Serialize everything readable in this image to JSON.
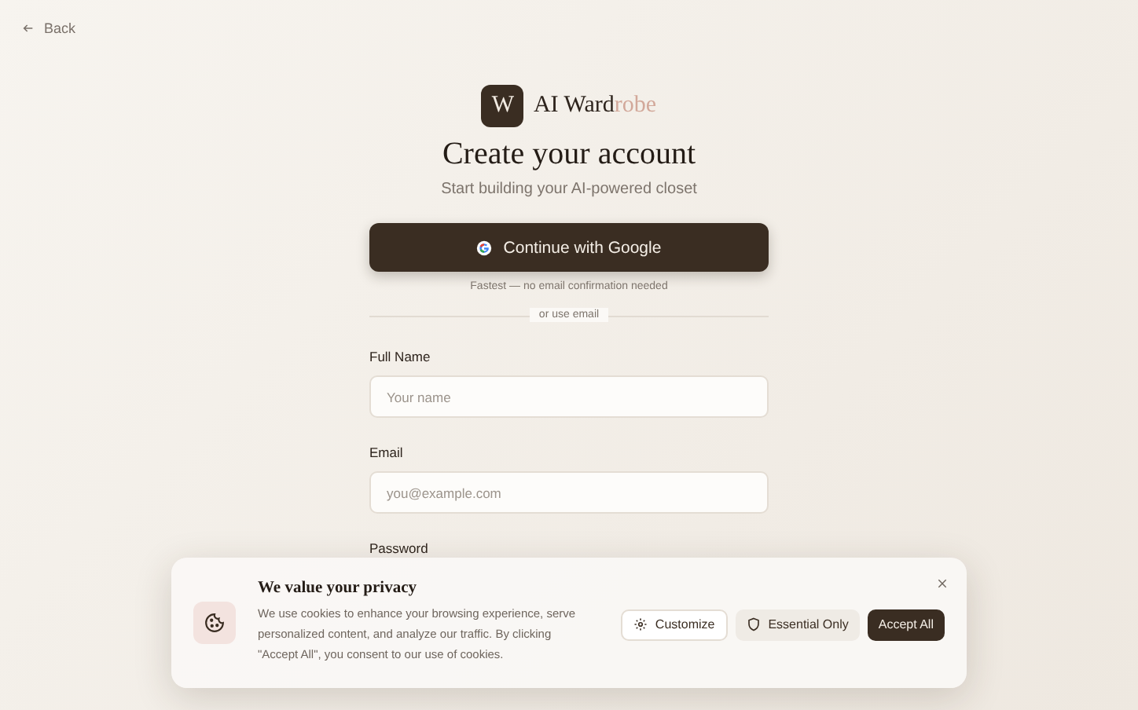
{
  "back_link": {
    "label": "Back"
  },
  "brand": {
    "mark": "W",
    "name_plain": "AI Ward",
    "name_accent": "robe"
  },
  "title": "Create your account",
  "subtitle": "Start building your AI-powered closet",
  "google_button": {
    "label": "Continue with Google"
  },
  "google_note": "Fastest — no email confirmation needed",
  "divider_label": "or use email",
  "fields": [
    {
      "label": "Full Name",
      "placeholder": "Your name"
    },
    {
      "label": "Email",
      "placeholder": "you@example.com"
    },
    {
      "label": "Password"
    }
  ],
  "cookie_banner": {
    "title": "We value your privacy",
    "text": "We use cookies to enhance your browsing experience, serve personalized content, and analyze our traffic. By clicking \"Accept All\", you consent to our use of cookies.",
    "buttons": [
      {
        "label": "Customize",
        "kind": "outline"
      },
      {
        "label": "Essential Only",
        "kind": "soft"
      },
      {
        "label": "Accept All",
        "kind": "primary"
      }
    ]
  }
}
